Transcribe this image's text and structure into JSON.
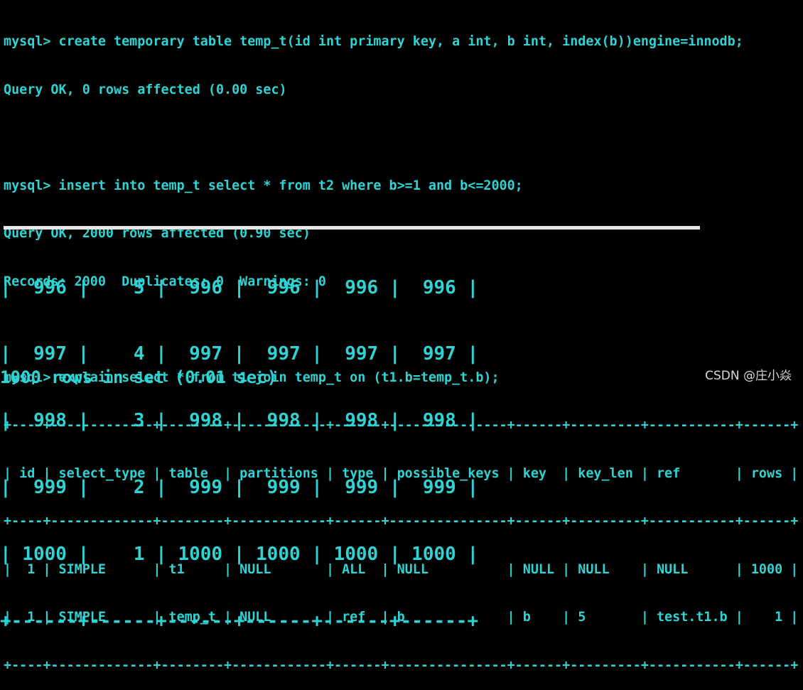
{
  "session": {
    "cmd1": "mysql> create temporary table temp_t(id int primary key, a int, b int, index(b))engine=innodb;",
    "res1": "Query OK, 0 rows affected (0.00 sec)",
    "cmd2": "mysql> insert into temp_t select * from t2 where b>=1 and b<=2000;",
    "res2": "Query OK, 2000 rows affected (0.90 sec)",
    "res2b": "Records: 2000  Duplicates: 0  Warnings: 0",
    "cmd3": "mysql> explain select * from t1 join temp_t on (t1.b=temp_t.b);"
  },
  "explain": {
    "sep": "+----+-------------+--------+------------+------+---------------+------+---------+-----------+------+",
    "header": "| id | select_type | table  | partitions | type | possible_keys | key  | key_len | ref       | rows |",
    "rows": [
      "|  1 | SIMPLE      | t1     | NULL       | ALL  | NULL          | NULL | NULL    | NULL      | 1000 |",
      "|  1 | SIMPLE      | temp_t | NULL       | ref  | b             | b    | 5       | test.t1.b |    1 |"
    ]
  },
  "results": {
    "rows": [
      "|  996 |    5 |  996 |  996 |  996 |  996 |",
      "|  997 |    4 |  997 |  997 |  997 |  997 |",
      "|  998 |    3 |  998 |  998 |  998 |  998 |",
      "|  999 |    2 |  999 |  999 |  999 |  999 |",
      "| 1000 |    1 | 1000 | 1000 | 1000 | 1000 |"
    ],
    "sep": "+------+------+------+------+------+------+",
    "summary": "1000 rows in set (0.01 sec)"
  },
  "watermark": "CSDN @庄小焱",
  "colors": {
    "background": "#000000",
    "text": "#2fd3d3",
    "divider": "#e6e6e6",
    "watermark": "#d8d8d8"
  }
}
